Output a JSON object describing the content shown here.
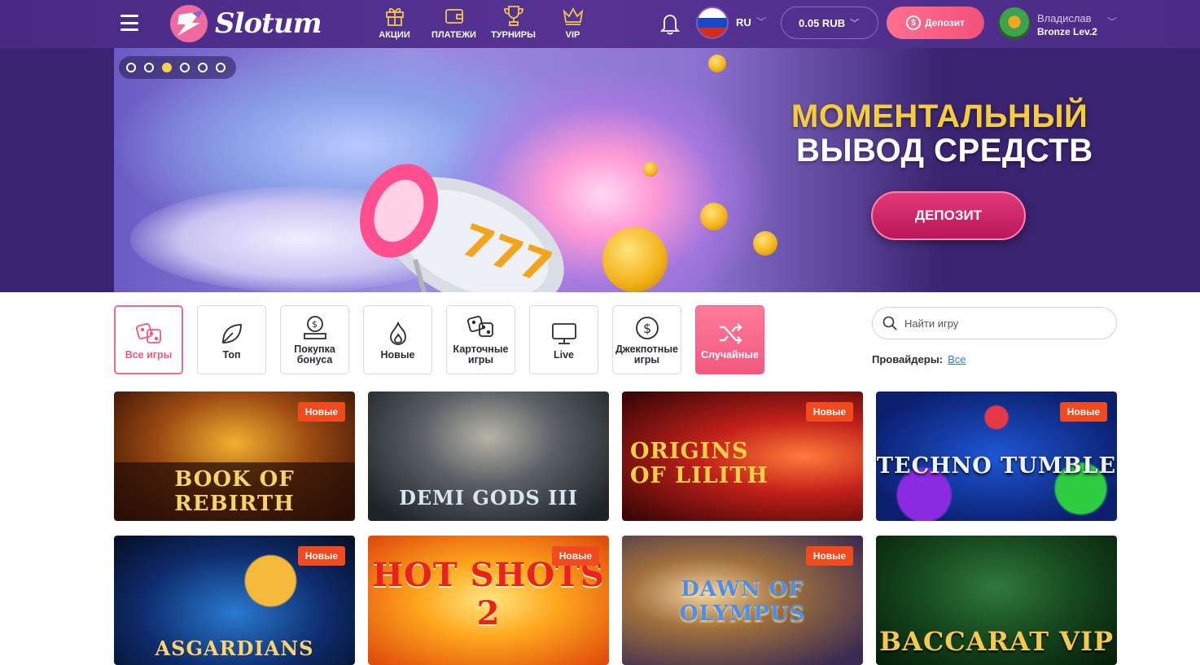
{
  "header": {
    "logo_text": "Slotum",
    "nav": [
      {
        "label": "АКЦИИ",
        "icon": "gift-icon"
      },
      {
        "label": "ПЛАТЕЖИ",
        "icon": "wallet-icon"
      },
      {
        "label": "ТУРНИРЫ",
        "icon": "trophy-icon"
      },
      {
        "label": "VIP",
        "icon": "crown-icon"
      }
    ],
    "language": "RU",
    "balance": "0.05 RUB",
    "deposit_label": "Депозит",
    "user": {
      "name": "Владислав",
      "level": "Bronze Lev.2"
    }
  },
  "hero": {
    "slides_count": 6,
    "active_slide": 3,
    "title_line1": "МОМЕНТАЛЬНЫЙ",
    "title_line2": "ВЫВОД СРЕДСТВ",
    "button_label": "ДЕПОЗИТ",
    "reel_text": "777"
  },
  "categories": [
    {
      "label": "Все игры",
      "icon": "dice-icon",
      "state": "active"
    },
    {
      "label": "Топ",
      "icon": "leaf-icon",
      "state": "normal"
    },
    {
      "label": "Покупка бонуса",
      "icon": "bonus-coin-icon",
      "state": "normal"
    },
    {
      "label": "Новые",
      "icon": "flame-icon",
      "state": "normal"
    },
    {
      "label": "Карточные игры",
      "icon": "cards-icon",
      "state": "normal"
    },
    {
      "label": "Live",
      "icon": "monitor-icon",
      "state": "normal"
    },
    {
      "label": "Джекпотные игры",
      "icon": "dollar-coin-icon",
      "state": "normal"
    },
    {
      "label": "Случайные",
      "icon": "shuffle-icon",
      "state": "highlight"
    }
  ],
  "search": {
    "placeholder": "Найти игру"
  },
  "providers": {
    "label": "Провайдеры:",
    "value": "Все"
  },
  "games": [
    {
      "title": "BOOK OF REBIRTH",
      "badge": "Новые"
    },
    {
      "title": "DEMI GODS III",
      "badge": ""
    },
    {
      "title": "ORIGINS OF LILITH",
      "badge": "Новые"
    },
    {
      "title": "TECHNO TUMBLE",
      "badge": "Новые"
    },
    {
      "title": "ASGARDIANS",
      "badge": "Новые"
    },
    {
      "title": "HOT SHOTS 2",
      "badge": "Новые"
    },
    {
      "title": "DAWN OF OLYMPUS",
      "badge": "Новые"
    },
    {
      "title": "BACCARAT VIP",
      "badge": ""
    }
  ],
  "colors": {
    "header": "#563393",
    "accent_pink": "#f2517a",
    "hero_yellow": "#f4cd3d",
    "badge": "#f04a1e",
    "link": "#2b7bd6"
  }
}
